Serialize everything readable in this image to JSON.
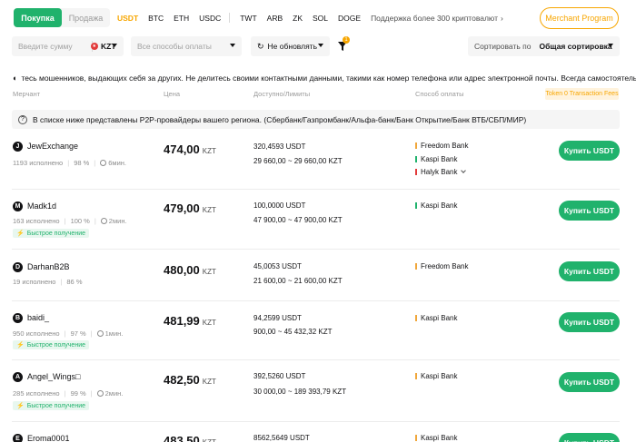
{
  "tabs": {
    "buy": "Покупка",
    "sell": "Продажа"
  },
  "coins": [
    "USDT",
    "BTC",
    "ETH",
    "USDC",
    "TWT",
    "ARB",
    "ZK",
    "SOL",
    "DOGE"
  ],
  "coin_more": "Поддержка более 300 криптовалют",
  "merchant_program": "Merchant Program",
  "filters": {
    "amount_placeholder": "Введите сумму",
    "currency": "KZT",
    "payment_placeholder": "Все способы оплаты",
    "refresh": "Не обновлять",
    "filter_badge": "1",
    "sort_label": "Сортировать по",
    "sort_value": "Общая сортировка"
  },
  "warning": "тесь мошенников, выдающих себя за других. Не делитесь своими контактными данными, такими как номер телефона или адрес электронной почты. Всегда самостоятельно проверяй",
  "headers": {
    "merchant": "Мерчант",
    "price": "Цена",
    "available": "Доступно/Лимиты",
    "payment": "Способ оплаты",
    "token_fee": "Token 0 Transaction Fees"
  },
  "notice": "В списке ниже представлены P2P-провайдеры вашего региона. (Сбербанк/Газпромбанк/Альфа-банк/Банк Открытие/Банк ВТБ/СБП/МИР)",
  "buy_label": "Купить USDT",
  "fast_label": "Быстрое получение",
  "price_currency": "KZT",
  "colors": {
    "green": "#20b26c",
    "orange": "#f7a600",
    "freedom": "#f0a63a",
    "kaspi": "#20b26c",
    "halyk": "#e23a3a"
  },
  "rows": [
    {
      "initial": "J",
      "name": "JewExchange",
      "orders": "1193 исполнено",
      "rate": "98 %",
      "time": "6мин.",
      "fast": false,
      "price": "474,00",
      "available": "320,4593 USDT",
      "limits": "29 660,00 ~ 29 660,00 KZT",
      "payments": [
        "Freedom Bank",
        "Kaspi Bank",
        "Halyk Bank"
      ]
    },
    {
      "initial": "M",
      "name": "Madk1d",
      "orders": "163 исполнено",
      "rate": "100 %",
      "time": "2мин.",
      "fast": true,
      "price": "479,00",
      "available": "100,0000 USDT",
      "limits": "47 900,00 ~ 47 900,00 KZT",
      "payments": [
        "Kaspi Bank"
      ]
    },
    {
      "initial": "D",
      "name": "DarhanB2B",
      "orders": "19 исполнено",
      "rate": "86 %",
      "time": "",
      "fast": false,
      "price": "480,00",
      "available": "45,0053 USDT",
      "limits": "21 600,00 ~ 21 600,00 KZT",
      "payments": [
        "Freedom Bank"
      ]
    },
    {
      "initial": "B",
      "name": "baidi_",
      "orders": "950 исполнено",
      "rate": "97 %",
      "time": "1мин.",
      "fast": true,
      "price": "481,99",
      "available": "94,2599 USDT",
      "limits": "900,00 ~ 45 432,32 KZT",
      "payments": [
        "Kaspi Bank"
      ]
    },
    {
      "initial": "A",
      "name": "Angel_Wings□",
      "orders": "285 исполнено",
      "rate": "99 %",
      "time": "2мин.",
      "fast": true,
      "price": "482,50",
      "available": "392,5260 USDT",
      "limits": "30 000,00 ~ 189 393,79 KZT",
      "payments": [
        "Kaspi Bank"
      ]
    },
    {
      "initial": "E",
      "name": "Eroma0001",
      "orders": "",
      "rate": "",
      "time": "",
      "fast": false,
      "price": "483,50",
      "available": "8562,5649 USDT",
      "limits": "",
      "payments": [
        "Kaspi Bank"
      ]
    }
  ]
}
